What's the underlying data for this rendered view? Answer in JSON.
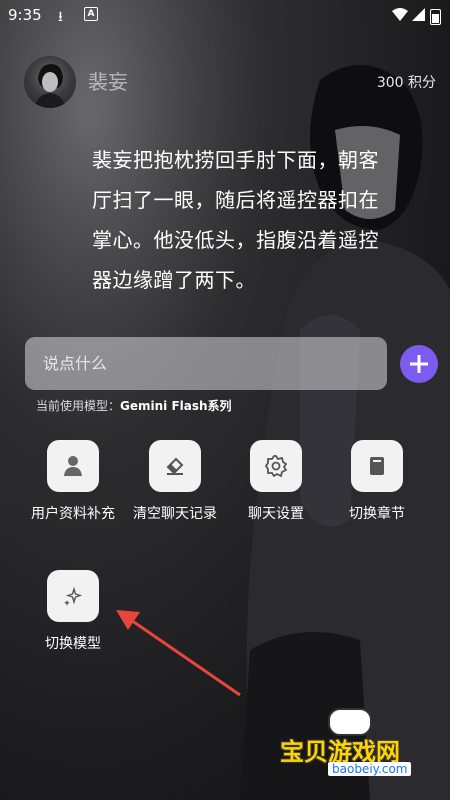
{
  "status_bar": {
    "time": "9:35"
  },
  "header": {
    "character_name": "裴妄",
    "points": "300 积分"
  },
  "story": {
    "text": "裴妄把抱枕捞回手肘下面，朝客厅扫了一眼，随后将遥控器扣在掌心。他没低头，指腹沿着遥控器边缘蹭了两下。"
  },
  "chat_input": {
    "placeholder": "说点什么"
  },
  "model_info": {
    "prefix": "当前使用模型：",
    "model_name": "Gemini Flash系列"
  },
  "actions": [
    {
      "label": "用户资料补充",
      "icon": "user-icon"
    },
    {
      "label": "清空聊天记录",
      "icon": "eraser-icon"
    },
    {
      "label": "聊天设置",
      "icon": "gear-icon"
    },
    {
      "label": "切换章节",
      "icon": "book-icon"
    },
    {
      "label": "切换模型",
      "icon": "sparkle-icon"
    }
  ],
  "watermark": {
    "title": "宝贝游戏网",
    "url": "baobeiy.com"
  },
  "colors": {
    "accent": "#7c5cf0",
    "annotation_arrow": "#e8453c"
  }
}
